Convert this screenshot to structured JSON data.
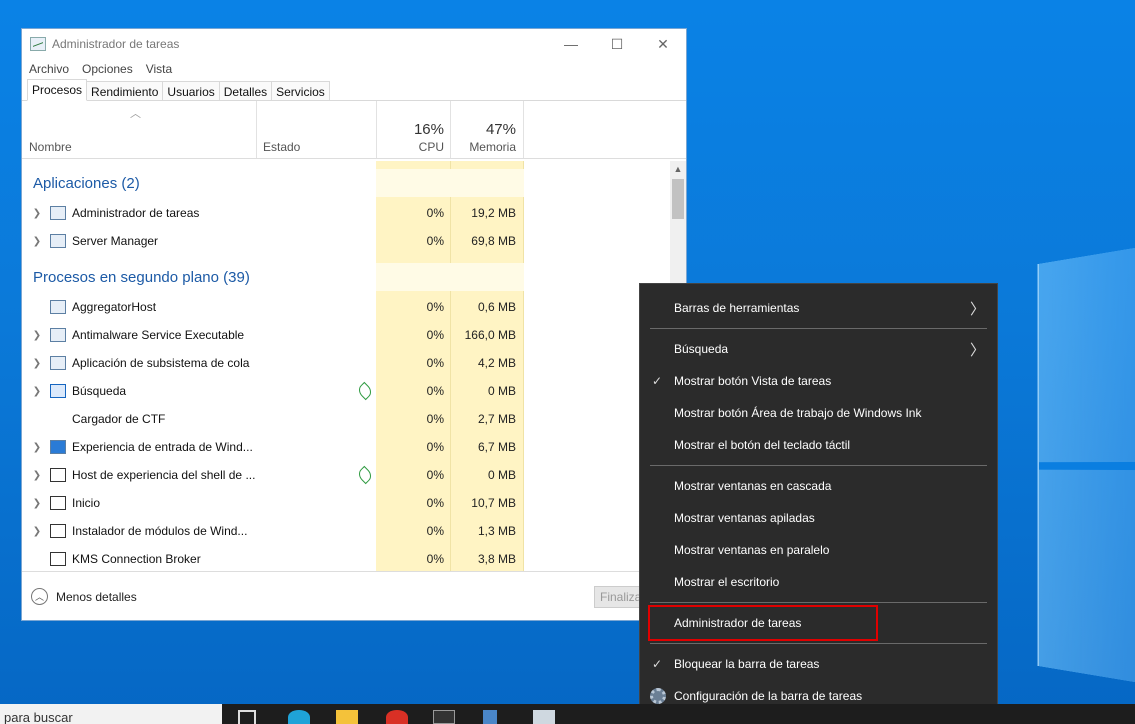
{
  "window": {
    "title": "Administrador de tareas",
    "minimize": "—",
    "maximize": "☐",
    "close": "✕"
  },
  "menubar": [
    "Archivo",
    "Opciones",
    "Vista"
  ],
  "tabs": [
    "Procesos",
    "Rendimiento",
    "Usuarios",
    "Detalles",
    "Servicios"
  ],
  "columns": {
    "name": "Nombre",
    "status": "Estado",
    "cpu_pct": "16%",
    "cpu": "CPU",
    "mem_pct": "47%",
    "mem": "Memoria"
  },
  "groups": {
    "apps": "Aplicaciones (2)",
    "background": "Procesos en segundo plano (39)"
  },
  "apps": [
    {
      "name": "Administrador de tareas",
      "cpu": "0%",
      "mem": "19,2 MB"
    },
    {
      "name": "Server Manager",
      "cpu": "0%",
      "mem": "69,8 MB"
    }
  ],
  "background": [
    {
      "name": "AggregatorHost",
      "cpu": "0%",
      "mem": "0,6 MB"
    },
    {
      "name": "Antimalware Service Executable",
      "cpu": "0%",
      "mem": "166,0 MB"
    },
    {
      "name": "Aplicación de subsistema de cola",
      "cpu": "0%",
      "mem": "4,2 MB"
    },
    {
      "name": "Búsqueda",
      "cpu": "0%",
      "mem": "0 MB"
    },
    {
      "name": "Cargador de CTF",
      "cpu": "0%",
      "mem": "2,7 MB"
    },
    {
      "name": "Experiencia de entrada de Wind...",
      "cpu": "0%",
      "mem": "6,7 MB"
    },
    {
      "name": "Host de experiencia del shell de ...",
      "cpu": "0%",
      "mem": "0 MB"
    },
    {
      "name": "Inicio",
      "cpu": "0%",
      "mem": "10,7 MB"
    },
    {
      "name": "Instalador de módulos de Wind...",
      "cpu": "0%",
      "mem": "1,3 MB"
    },
    {
      "name": "KMS Connection Broker",
      "cpu": "0%",
      "mem": "3,8 MB"
    }
  ],
  "footer": {
    "fewer_details": "Menos detalles",
    "end_task": "Finalizar tarea"
  },
  "context_menu": {
    "toolbars": "Barras de herramientas",
    "search": "Búsqueda",
    "show_task_view": "Mostrar botón Vista de tareas",
    "show_ink": "Mostrar botón Área de trabajo de Windows Ink",
    "show_keyboard": "Mostrar el botón del teclado táctil",
    "cascade": "Mostrar ventanas en cascada",
    "stacked": "Mostrar ventanas apiladas",
    "side_by_side": "Mostrar ventanas en paralelo",
    "show_desktop": "Mostrar el escritorio",
    "task_manager": "Administrador de tareas",
    "lock_taskbar": "Bloquear la barra de tareas",
    "taskbar_settings": "Configuración de la barra de tareas",
    "checkmark": "✓",
    "chevron": "〉"
  },
  "taskbar": {
    "search_placeholder": "para buscar"
  }
}
